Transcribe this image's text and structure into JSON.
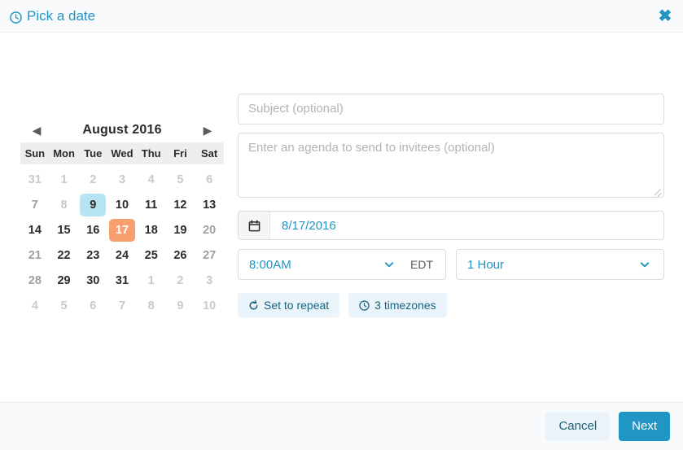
{
  "header": {
    "title": "Pick a date",
    "clock_icon": "clock-icon",
    "close_icon": "✖"
  },
  "calendar": {
    "prev_label": "◀",
    "next_label": "▶",
    "month": "August",
    "year": "2016",
    "title": "August  2016",
    "weekdays": [
      "Sun",
      "Mon",
      "Tue",
      "Wed",
      "Thu",
      "Fri",
      "Sat"
    ],
    "today": "9",
    "selected": "17",
    "weeks": [
      [
        {
          "d": "31",
          "state": "muted"
        },
        {
          "d": "1",
          "state": "muted"
        },
        {
          "d": "2",
          "state": "muted"
        },
        {
          "d": "3",
          "state": "muted"
        },
        {
          "d": "4",
          "state": "muted"
        },
        {
          "d": "5",
          "state": "muted"
        },
        {
          "d": "6",
          "state": "muted"
        }
      ],
      [
        {
          "d": "7",
          "state": "weekend"
        },
        {
          "d": "8",
          "state": "muted"
        },
        {
          "d": "9",
          "state": "today"
        },
        {
          "d": "10",
          "state": "normal"
        },
        {
          "d": "11",
          "state": "normal"
        },
        {
          "d": "12",
          "state": "normal"
        },
        {
          "d": "13",
          "state": "normal"
        }
      ],
      [
        {
          "d": "14",
          "state": "normal"
        },
        {
          "d": "15",
          "state": "normal"
        },
        {
          "d": "16",
          "state": "normal"
        },
        {
          "d": "17",
          "state": "selected"
        },
        {
          "d": "18",
          "state": "normal"
        },
        {
          "d": "19",
          "state": "normal"
        },
        {
          "d": "20",
          "state": "weekend"
        }
      ],
      [
        {
          "d": "21",
          "state": "weekend"
        },
        {
          "d": "22",
          "state": "normal"
        },
        {
          "d": "23",
          "state": "normal"
        },
        {
          "d": "24",
          "state": "normal"
        },
        {
          "d": "25",
          "state": "normal"
        },
        {
          "d": "26",
          "state": "normal"
        },
        {
          "d": "27",
          "state": "weekend"
        }
      ],
      [
        {
          "d": "28",
          "state": "weekend"
        },
        {
          "d": "29",
          "state": "normal"
        },
        {
          "d": "30",
          "state": "normal"
        },
        {
          "d": "31",
          "state": "normal"
        },
        {
          "d": "1",
          "state": "muted"
        },
        {
          "d": "2",
          "state": "muted"
        },
        {
          "d": "3",
          "state": "muted"
        }
      ],
      [
        {
          "d": "4",
          "state": "muted"
        },
        {
          "d": "5",
          "state": "muted"
        },
        {
          "d": "6",
          "state": "muted"
        },
        {
          "d": "7",
          "state": "muted"
        },
        {
          "d": "8",
          "state": "muted"
        },
        {
          "d": "9",
          "state": "muted"
        },
        {
          "d": "10",
          "state": "muted"
        }
      ]
    ]
  },
  "form": {
    "subject": {
      "value": "",
      "placeholder": "Subject (optional)"
    },
    "agenda": {
      "value": "",
      "placeholder": "Enter an agenda to send to invitees (optional)"
    },
    "date": {
      "icon": "calendar-icon",
      "value": "8/17/2016"
    },
    "time": {
      "value": "8:00AM",
      "chevron": "chevron-down-icon",
      "timezone": "EDT"
    },
    "duration": {
      "value": "1 Hour",
      "chevron": "chevron-down-icon"
    },
    "options": [
      {
        "label": "Set to repeat",
        "icon": "repeat-icon"
      },
      {
        "label": "3 timezones",
        "icon": "clock-icon"
      }
    ]
  },
  "footer": {
    "cancel_label": "Cancel",
    "next_label": "Next"
  },
  "colors": {
    "accent_blue": "#2196c4",
    "today_blue": "#b7e4f2",
    "selected_orange": "#f79f6e",
    "pill_bg": "#eaf4fa",
    "chrome_gray": "#f9fafb"
  }
}
